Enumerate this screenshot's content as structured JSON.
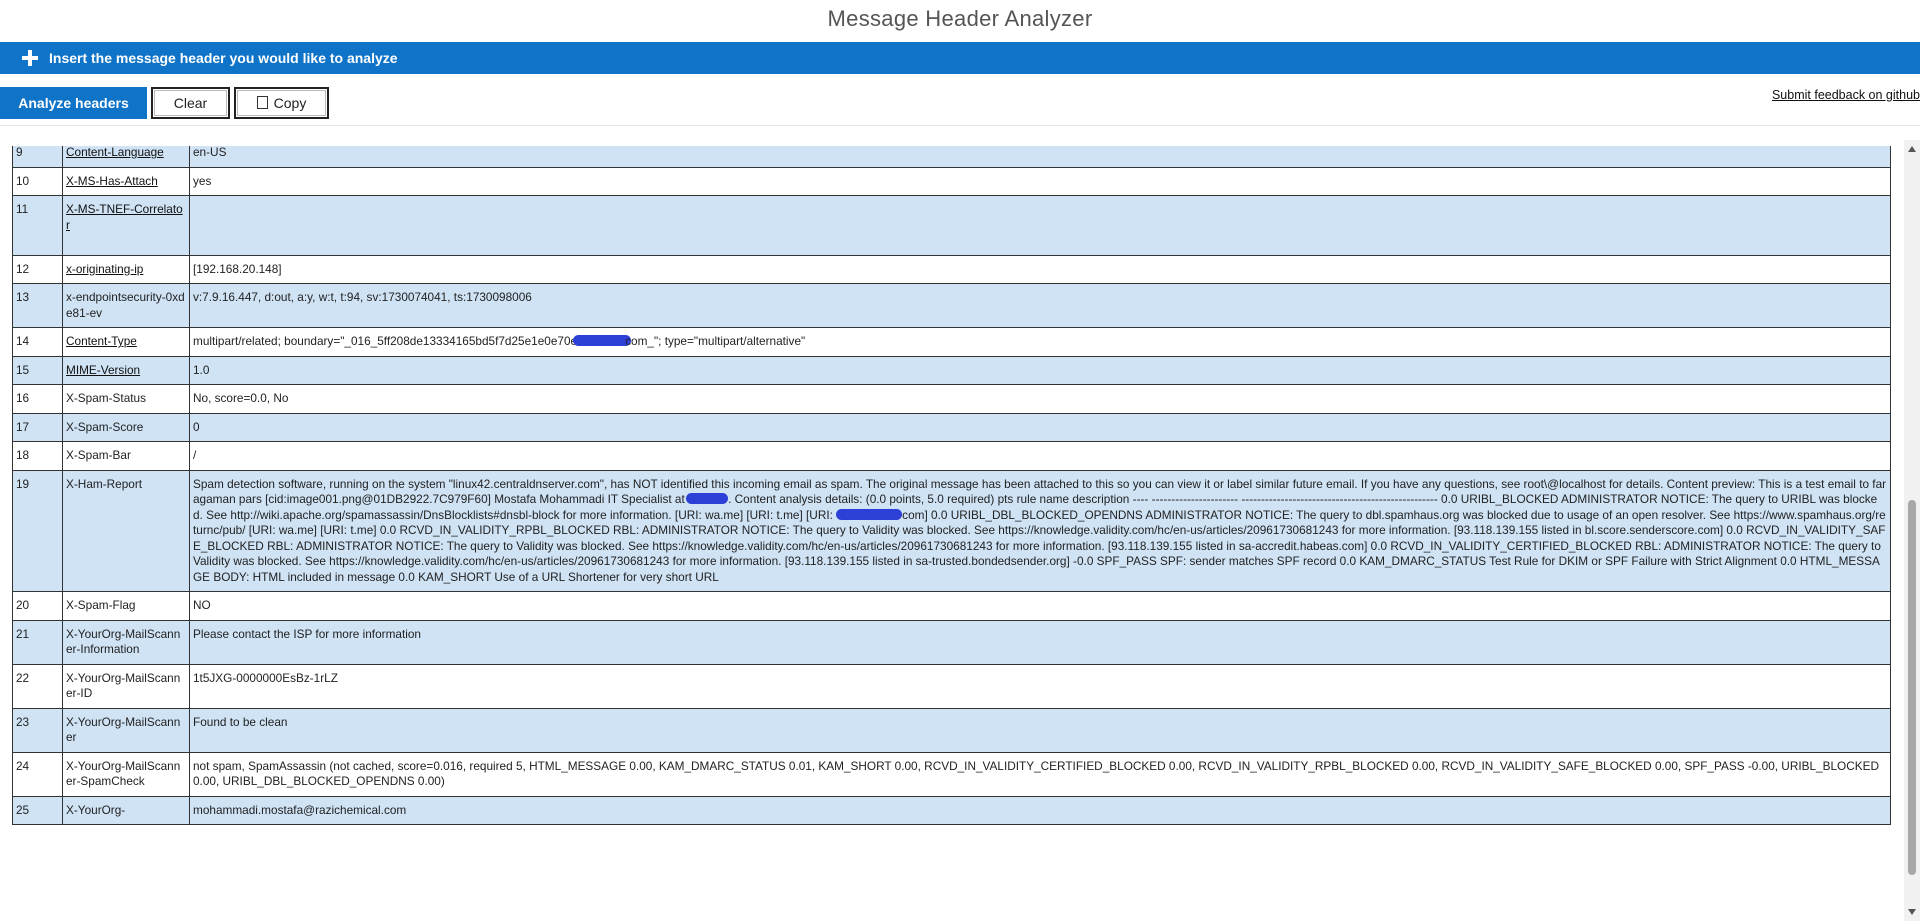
{
  "app": {
    "title": "Message Header Analyzer"
  },
  "insert_bar": {
    "label": "Insert the message header you would like to analyze",
    "color": "#0f74c7"
  },
  "toolbar": {
    "analyze_label": "Analyze headers",
    "clear_label": "Clear",
    "copy_label": "Copy",
    "feedback_label": "Submit feedback on github"
  },
  "headers": [
    {
      "num": "9",
      "name": "Content-Language",
      "link": true,
      "value": "en-US"
    },
    {
      "num": "10",
      "name": "X-MS-Has-Attach",
      "link": true,
      "value": "yes"
    },
    {
      "num": "11",
      "name": "X-MS-TNEF-Correlator",
      "link": true,
      "value": ""
    },
    {
      "num": "12",
      "name": "x-originating-ip",
      "link": true,
      "value": "[192.168.20.148]"
    },
    {
      "num": "13",
      "name": "x-endpointsecurity-0xde81-ev",
      "link": false,
      "value": "v:7.9.16.447, d:out, a:y, w:t, t:94, sv:1730074041, ts:1730098006"
    },
    {
      "num": "14",
      "name": "Content-Type",
      "link": true,
      "value_before": "multipart/related; boundary=\"_016_5ff208de13334165bd5f7d25e1e0e70e",
      "value_after": "com_\"; type=\"multipart/alternative\""
    },
    {
      "num": "15",
      "name": "MIME-Version",
      "link": true,
      "value": "1.0"
    },
    {
      "num": "16",
      "name": "X-Spam-Status",
      "link": false,
      "value": "No, score=0.0, No"
    },
    {
      "num": "17",
      "name": "X-Spam-Score",
      "link": false,
      "value": "0"
    },
    {
      "num": "18",
      "name": "X-Spam-Bar",
      "link": false,
      "value": "/"
    },
    {
      "num": "19",
      "name": "X-Ham-Report",
      "link": false,
      "value_part1": "Spam detection software, running on the system \"linux42.centraldnserver.com\", has NOT identified this incoming email as spam. The original message has been attached to this so you can view it or label similar future email. If you have any questions, see root\\@localhost for details. Content preview: This is a test email to faragaman pars [cid:image001.png@01DB2922.7C979F60] Mostafa Mohammadi IT Specialist at ",
      "value_part2": ". Content analysis details: (0.0 points, 5.0 required) pts rule name description ---- ---------------------- -------------------------------------------------- 0.0 URIBL_BLOCKED ADMINISTRATOR NOTICE: The query to URIBL was blocked. See http://wiki.apache.org/spamassassin/DnsBlocklists#dnsbl-block for more information. [URI: wa.me] [URI: t.me] [URI: ",
      "value_part3": "com] 0.0 URIBL_DBL_BLOCKED_OPENDNS ADMINISTRATOR NOTICE: The query to dbl.spamhaus.org was blocked due to usage of an open resolver. See https://www.spamhaus.org/returnc/pub/ [URI: wa.me] [URI: t.me] 0.0 RCVD_IN_VALIDITY_RPBL_BLOCKED RBL: ADMINISTRATOR NOTICE: The query to Validity was blocked. See https://knowledge.validity.com/hc/en-us/articles/20961730681243 for more information. [93.118.139.155 listed in bl.score.senderscore.com] 0.0 RCVD_IN_VALIDITY_SAFE_BLOCKED RBL: ADMINISTRATOR NOTICE: The query to Validity was blocked. See https://knowledge.validity.com/hc/en-us/articles/20961730681243 for more information. [93.118.139.155 listed in sa-accredit.habeas.com] 0.0 RCVD_IN_VALIDITY_CERTIFIED_BLOCKED RBL: ADMINISTRATOR NOTICE: The query to Validity was blocked. See https://knowledge.validity.com/hc/en-us/articles/20961730681243 for more information. [93.118.139.155 listed in sa-trusted.bondedsender.org] -0.0 SPF_PASS SPF: sender matches SPF record 0.0 KAM_DMARC_STATUS Test Rule for DKIM or SPF Failure with Strict Alignment 0.0 HTML_MESSAGE BODY: HTML included in message 0.0 KAM_SHORT Use of a URL Shortener for very short URL"
    },
    {
      "num": "20",
      "name": "X-Spam-Flag",
      "link": false,
      "value": "NO"
    },
    {
      "num": "21",
      "name": "X-YourOrg-MailScanner-Information",
      "link": false,
      "value": "Please contact the ISP for more information"
    },
    {
      "num": "22",
      "name": "X-YourOrg-MailScanner-ID",
      "link": false,
      "value": "1t5JXG-0000000EsBz-1rLZ"
    },
    {
      "num": "23",
      "name": "X-YourOrg-MailScanner",
      "link": false,
      "value": "Found to be clean"
    },
    {
      "num": "24",
      "name": "X-YourOrg-MailScanner-SpamCheck",
      "link": false,
      "value": "not spam, SpamAssassin (not cached, score=0.016, required 5, HTML_MESSAGE 0.00, KAM_DMARC_STATUS 0.01, KAM_SHORT 0.00, RCVD_IN_VALIDITY_CERTIFIED_BLOCKED 0.00, RCVD_IN_VALIDITY_RPBL_BLOCKED 0.00, RCVD_IN_VALIDITY_SAFE_BLOCKED 0.00, SPF_PASS -0.00, URIBL_BLOCKED 0.00, URIBL_DBL_BLOCKED_OPENDNS 0.00)"
    },
    {
      "num": "25",
      "name": "X-YourOrg-",
      "link": false,
      "value": "mohammadi.mostafa@razichemical.com"
    }
  ]
}
